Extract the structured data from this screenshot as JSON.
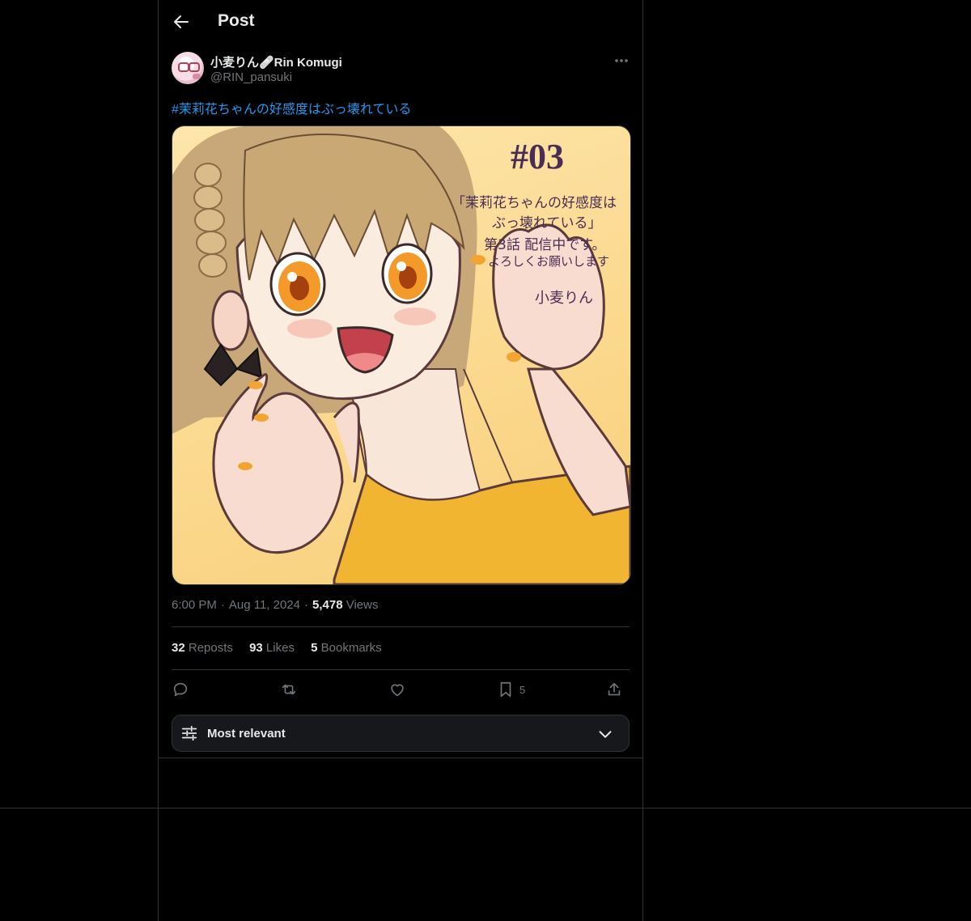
{
  "header": {
    "title": "Post"
  },
  "post": {
    "author_name": "小麦りん🩹Rin Komugi",
    "author_handle": "@RIN_pansuki",
    "hashtag": "#茉莉花ちゃんの好感度はぶっ壊れている",
    "image": {
      "number": "#03",
      "text_line1": "「茉莉花ちゃんの好感度は",
      "text_line2": "ぶっ壊れている」",
      "text_line3": "第3話 配信中です。",
      "text_line4": "よろしくお願いします",
      "signature": "小麦りん"
    },
    "time": "6:00 PM",
    "separator": "·",
    "date": "Aug 11, 2024",
    "views_count": "5,478",
    "views_label": "Views"
  },
  "stats": {
    "reposts_count": "32",
    "reposts_label": "Reposts",
    "likes_count": "93",
    "likes_label": "Likes",
    "bookmarks_count": "5",
    "bookmarks_label": "Bookmarks"
  },
  "actions": {
    "bookmark_count": "5"
  },
  "sort": {
    "label": "Most relevant"
  },
  "icons": [
    "back-arrow-icon",
    "more-icon",
    "reply-icon",
    "repost-icon",
    "like-icon",
    "bookmark-icon",
    "share-icon",
    "sliders-icon",
    "chevron-down-icon"
  ],
  "colors": {
    "background": "#000000",
    "text": "#e7e9ea",
    "muted": "#71767b",
    "link": "#1d9bf0",
    "border": "#2f3336"
  }
}
